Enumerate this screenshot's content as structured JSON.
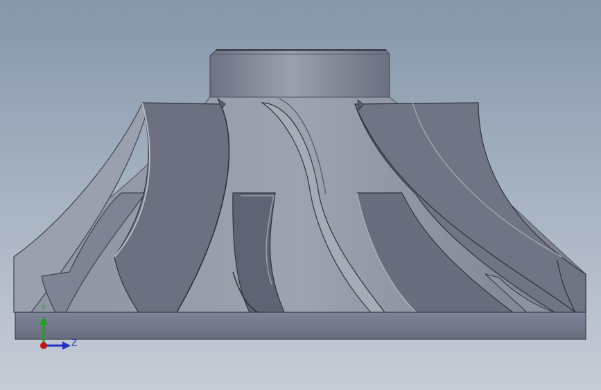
{
  "viewport": {
    "view": "3d-model-viewport",
    "background_top": "#8697aa",
    "background_bottom": "#c6ccd6",
    "model_color": "#6f7584"
  },
  "triad": {
    "z_label": "Z",
    "y_label": "Y",
    "colors": {
      "x": "#c01818",
      "y": "#22a022",
      "z": "#2030c0"
    }
  }
}
